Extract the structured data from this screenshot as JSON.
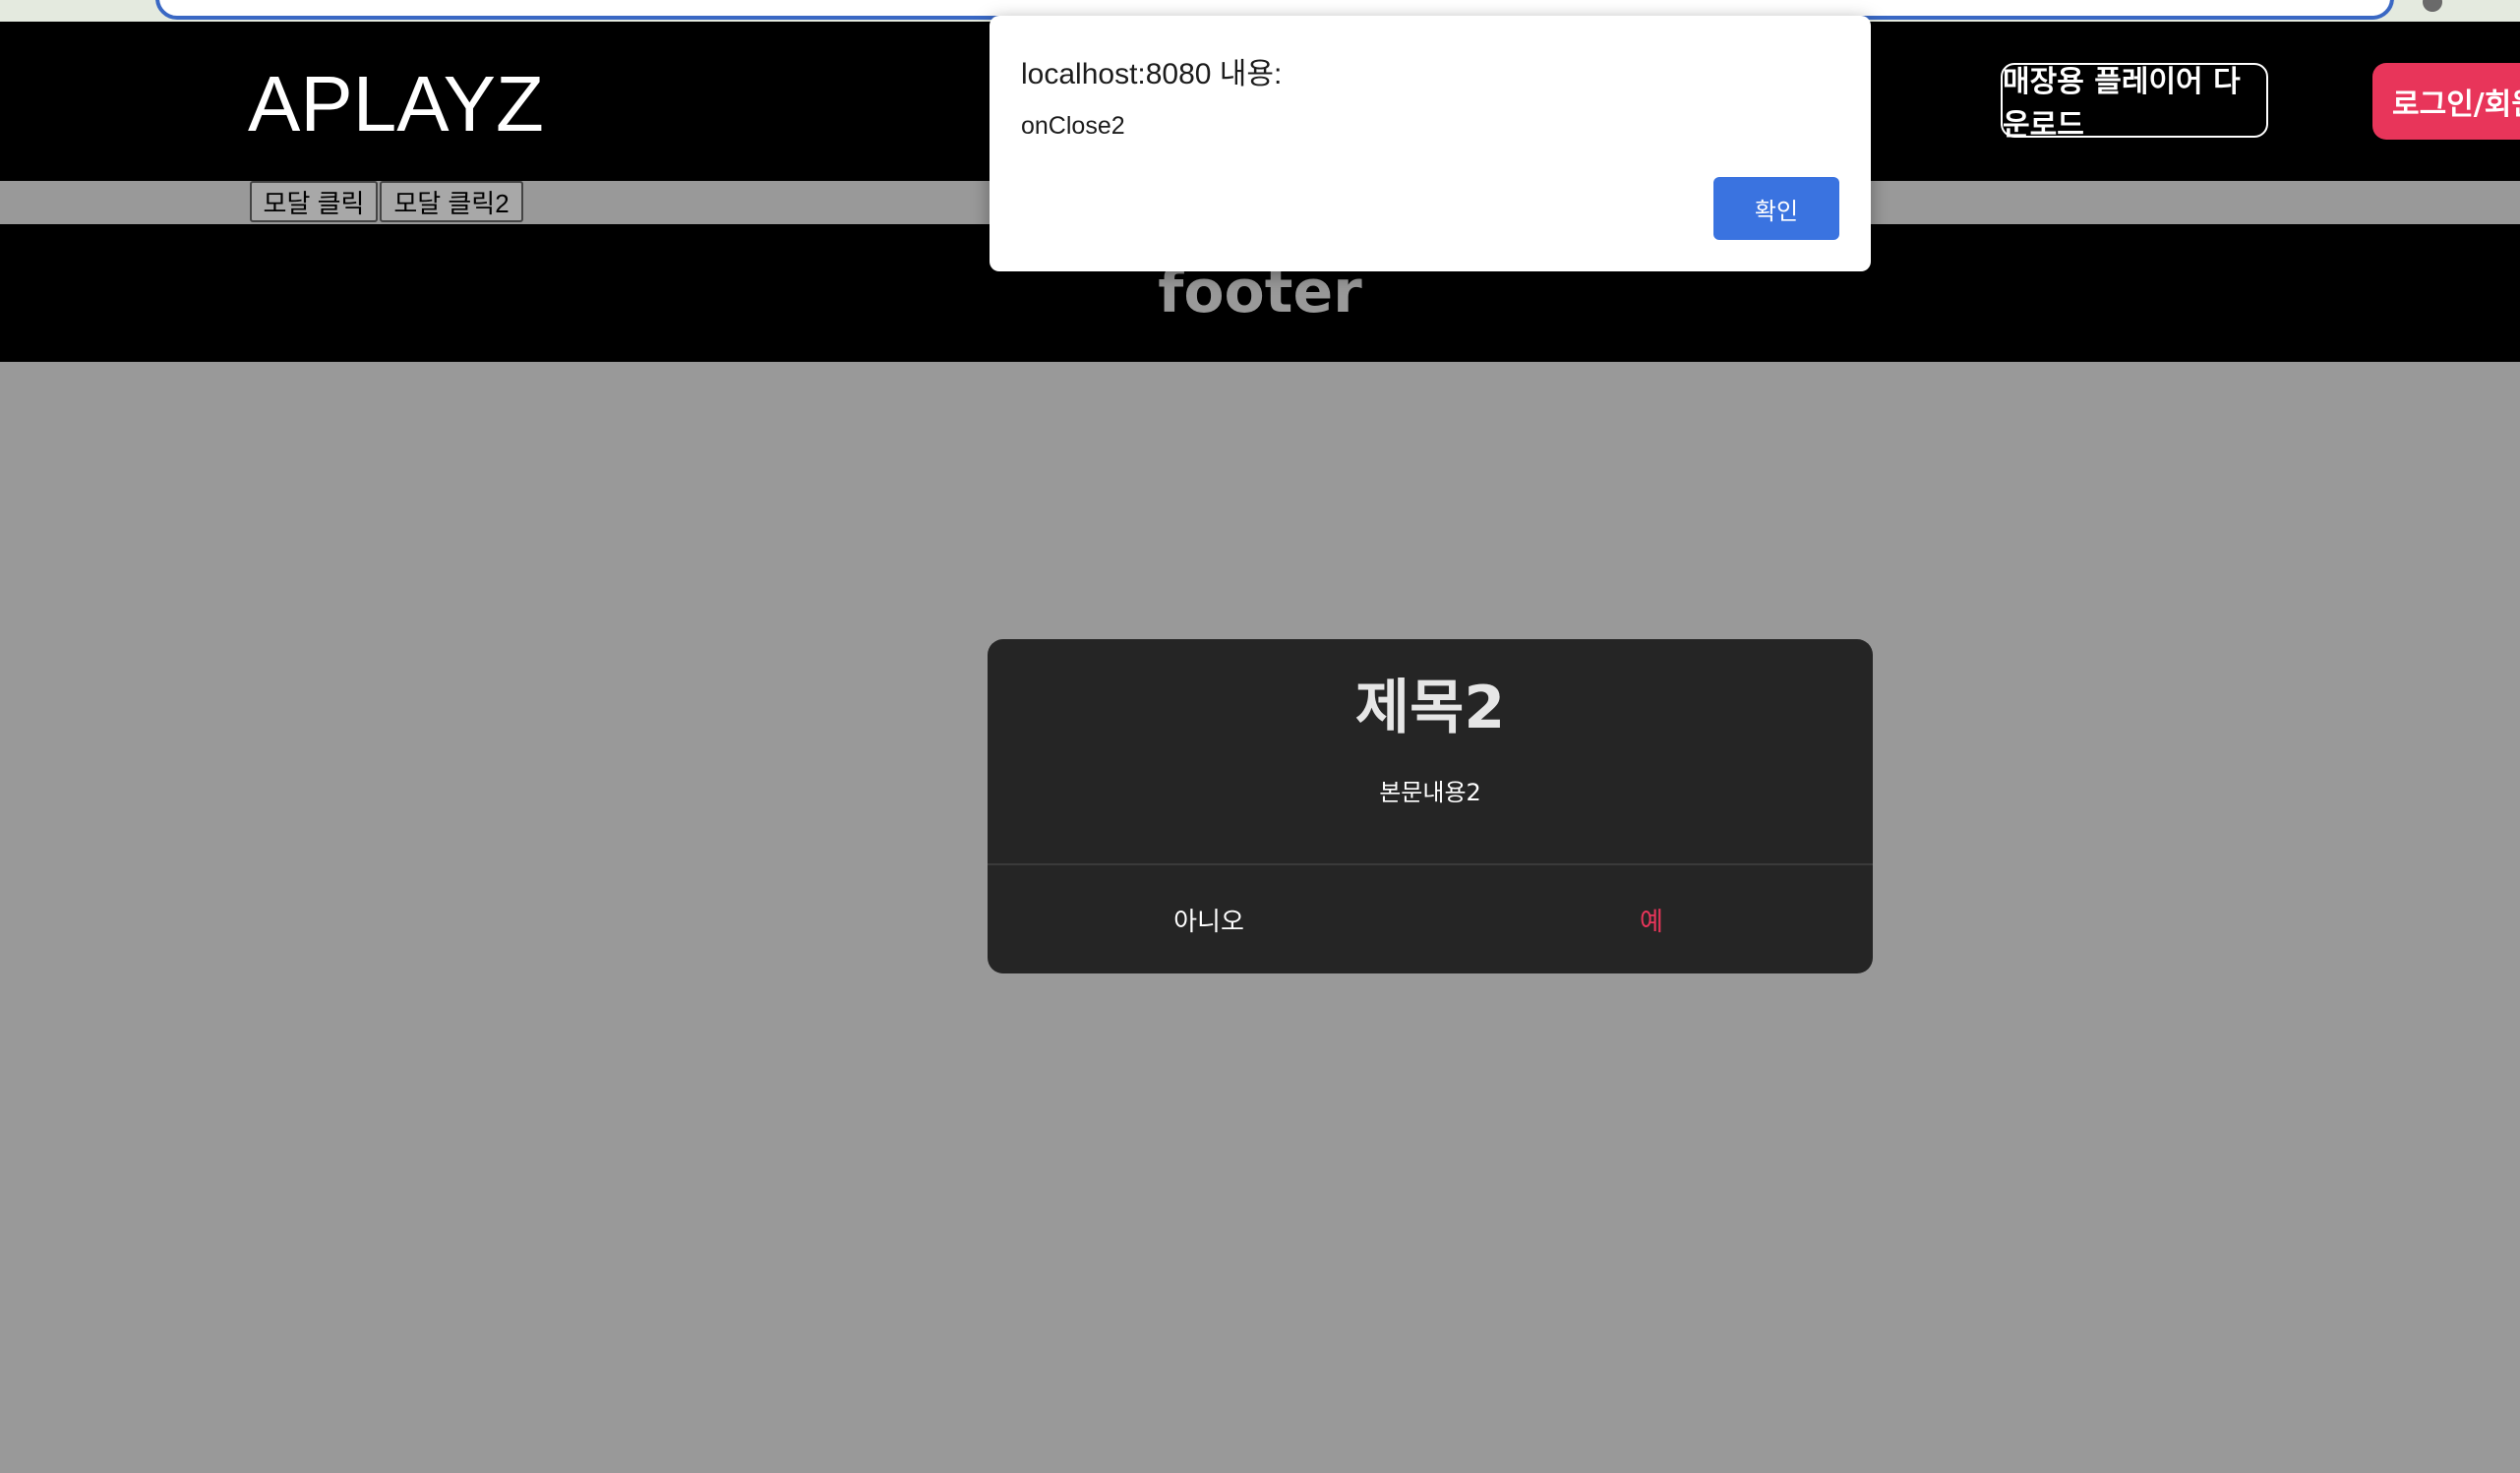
{
  "header": {
    "logo": "APLAYZ",
    "download_label": "매장용 플레이어 다운로드",
    "login_label": "로그인/회원"
  },
  "triggers": {
    "modal1_label": "모달 클릭",
    "modal2_label": "모달 클릭2"
  },
  "footer": {
    "text": "footer"
  },
  "modal": {
    "title": "제목2",
    "body": "본문내용2",
    "no_label": "아니오",
    "yes_label": "예"
  },
  "alert": {
    "origin": "localhost:8080 내용:",
    "message": "onClose2",
    "ok_label": "확인"
  },
  "colors": {
    "accent": "#e8355a",
    "alert_button": "#3a73e0",
    "overlay": "#999999",
    "modal_bg": "#252525"
  }
}
